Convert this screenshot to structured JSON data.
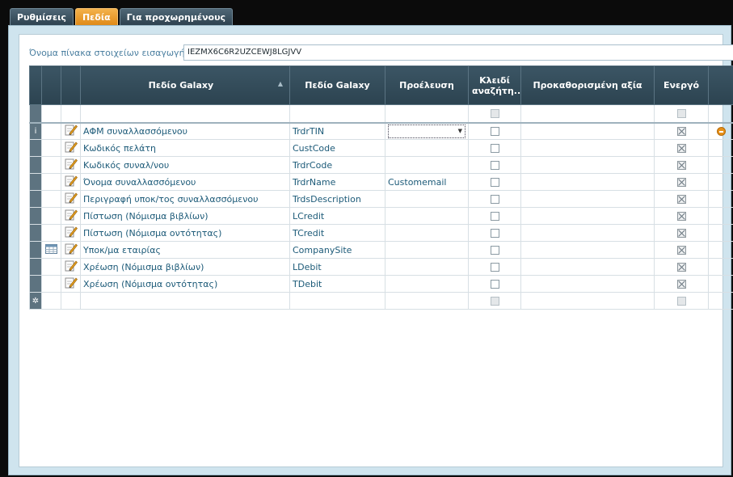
{
  "tabs": [
    {
      "label": "Ρυθμίσεις",
      "active": false
    },
    {
      "label": "Πεδία",
      "active": true
    },
    {
      "label": "Για προχωρημένους",
      "active": false
    }
  ],
  "table_name": {
    "label": "Όνομα πίνακα στοιχείων εισαγωγής",
    "value": "IEZMX6C6R2UZCEWJ8LGJVV",
    "help": "?"
  },
  "grid": {
    "columns": {
      "galaxy_field_1": "Πεδίο Galaxy",
      "galaxy_field_2": "Πεδίο Galaxy",
      "source": "Προέλευση",
      "lookup_key": "Κλειδί αναζήτη...",
      "default_value": "Προκαθορισμένη αξία",
      "active": "Ενεργό",
      "sort_indicator": "▲"
    },
    "current_row_indicator": "i",
    "new_row_indicator": "✲",
    "rows": [
      {
        "label": "ΑΦΜ συναλλασσόμενου",
        "field": "TrdrTIN",
        "source": "",
        "lookup": false,
        "default": "",
        "active": true,
        "icon": "edit-icon"
      },
      {
        "label": "Κωδικός πελάτη",
        "field": "CustCode",
        "source": "",
        "lookup": false,
        "default": "",
        "active": true,
        "icon": "edit-icon"
      },
      {
        "label": "Κωδικός συναλ/νου",
        "field": "TrdrCode",
        "source": "",
        "lookup": false,
        "default": "",
        "active": true,
        "icon": "edit-icon"
      },
      {
        "label": "Όνομα συναλλασσόμενου",
        "field": "TrdrName",
        "source": "Customemail",
        "lookup": false,
        "default": "",
        "active": true,
        "icon": "edit-icon"
      },
      {
        "label": "Περιγραφή υποκ/τος συναλλασσόμενου",
        "field": "TrdsDescription",
        "source": "",
        "lookup": false,
        "default": "",
        "active": true,
        "icon": "edit-icon"
      },
      {
        "label": "Πίστωση (Νόμισμα βιβλίων)",
        "field": "LCredit",
        "source": "",
        "lookup": false,
        "default": "",
        "active": true,
        "icon": "edit-icon"
      },
      {
        "label": "Πίστωση (Νόμισμα οντότητας)",
        "field": "TCredit",
        "source": "",
        "lookup": false,
        "default": "",
        "active": true,
        "icon": "edit-icon"
      },
      {
        "label": "Υποκ/μα εταιρίας",
        "field": "CompanySite",
        "source": "",
        "lookup": false,
        "default": "",
        "active": true,
        "icon": "edit-icon",
        "extra_icon": "table-icon"
      },
      {
        "label": "Χρέωση (Νόμισμα βιβλίων)",
        "field": "LDebit",
        "source": "",
        "lookup": false,
        "default": "",
        "active": true,
        "icon": "edit-icon"
      },
      {
        "label": "Χρέωση (Νόμισμα οντότητας)",
        "field": "TDebit",
        "source": "",
        "lookup": false,
        "default": "",
        "active": true,
        "icon": "edit-icon"
      }
    ]
  },
  "colors": {
    "header_bg": "#2f4552",
    "active_tab": "#e8961f",
    "row_text": "#1c5a78",
    "panel_bg": "#cfe4ee"
  }
}
